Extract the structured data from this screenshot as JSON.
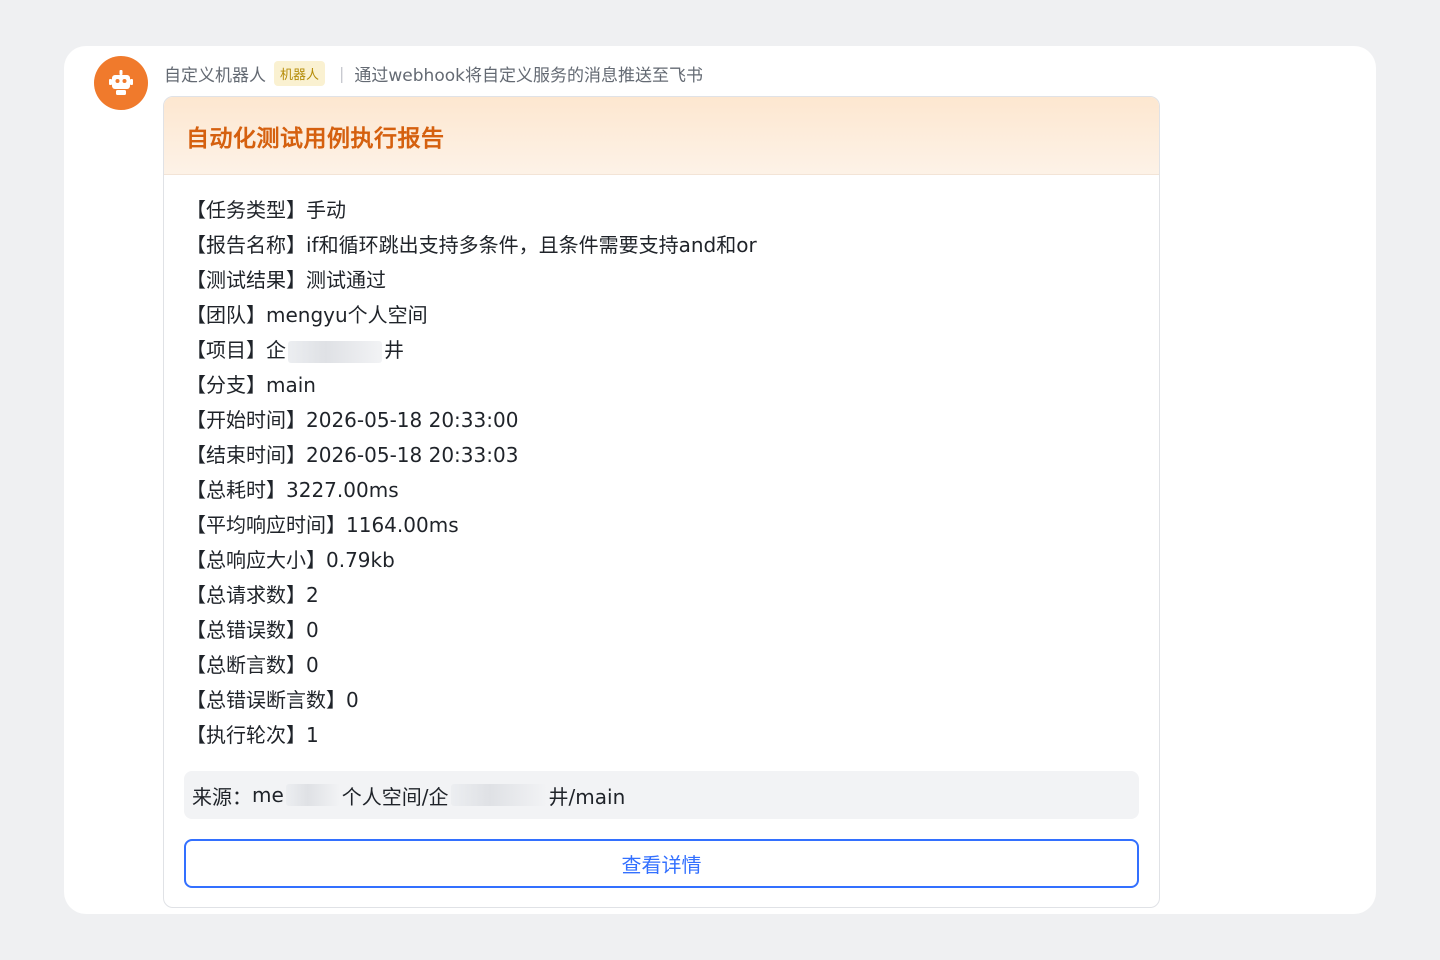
{
  "sender": {
    "name": "自定义机器人",
    "badge": "机器人",
    "description": "通过webhook将自定义服务的消息推送至飞书"
  },
  "card": {
    "title": "自动化测试用例执行报告",
    "fields": [
      {
        "label": "【任务类型】",
        "value": "手动"
      },
      {
        "label": "【报告名称】",
        "value": "if和循环跳出支持多条件，且条件需要支持and和or"
      },
      {
        "label": "【测试结果】",
        "value": "测试通过"
      },
      {
        "label": "【团队】",
        "value": "mengyu个人空间"
      },
      {
        "label": "【项目】",
        "value_prefix": "企",
        "value_suffix": "井"
      },
      {
        "label": "【分支】",
        "value": "main"
      },
      {
        "label": "【开始时间】",
        "value": "2026-05-18 20:33:00"
      },
      {
        "label": "【结束时间】",
        "value": "2026-05-18 20:33:03"
      },
      {
        "label": "【总耗时】",
        "value": "3227.00ms"
      },
      {
        "label": "【平均响应时间】",
        "value": "1164.00ms"
      },
      {
        "label": "【总响应大小】",
        "value": "0.79kb"
      },
      {
        "label": "【总请求数】",
        "value": "2"
      },
      {
        "label": "【总错误数】",
        "value": "0"
      },
      {
        "label": "【总断言数】",
        "value": "0"
      },
      {
        "label": "【总错误断言数】",
        "value": "0"
      },
      {
        "label": "【执行轮次】",
        "value": "1"
      }
    ],
    "source": {
      "label": "来源：",
      "part1": "me",
      "part2": "个人空间/企",
      "part3": "井/main"
    },
    "button_label": "查看详情"
  },
  "colors": {
    "accent": "#3370ff",
    "title": "#d5600f",
    "avatar": "#f07a2c"
  },
  "icons": {
    "avatar": "robot-icon"
  }
}
